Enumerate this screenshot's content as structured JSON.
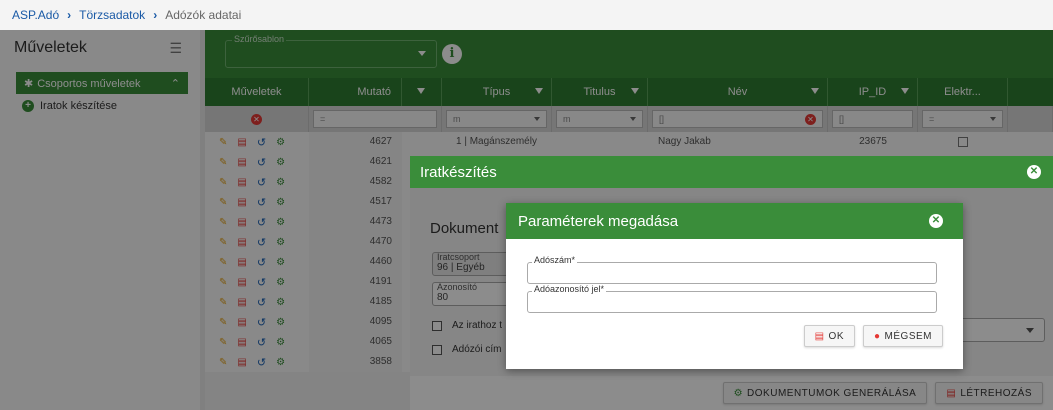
{
  "breadcrumb": {
    "items": [
      "ASP.Adó",
      "Törzsadatok"
    ],
    "current": "Adózók adatai"
  },
  "sidebar": {
    "title": "Műveletek",
    "group_label": "Csoportos műveletek",
    "item_label": "Iratok készítése"
  },
  "filterbar": {
    "template_label": "Szűrősablon"
  },
  "grid": {
    "headers": [
      "Műveletek",
      "Mutató",
      "Típus",
      "Titulus",
      "Név",
      "IP_ID",
      "Elektr..."
    ],
    "filter_values": [
      "=",
      "m",
      "m",
      "[]",
      "[]",
      "="
    ],
    "rows": [
      {
        "mutato": "4627",
        "tipus": "1 | Magánszemély",
        "nev": "Nagy Jakab",
        "ip_id": "23675"
      },
      {
        "mutato": "4621"
      },
      {
        "mutato": "4582"
      },
      {
        "mutato": "4517"
      },
      {
        "mutato": "4473"
      },
      {
        "mutato": "4470"
      },
      {
        "mutato": "4460"
      },
      {
        "mutato": "4191"
      },
      {
        "mutato": "4185"
      },
      {
        "mutato": "4095"
      },
      {
        "mutato": "4065"
      },
      {
        "mutato": "3858"
      }
    ]
  },
  "dialog_outer": {
    "title": "Iratkészítés",
    "section_title": "Dokument",
    "iratcsoport_label": "Iratcsoport",
    "iratcsoport_value": "96 | Egyéb",
    "azonosito_label": "Azonosító",
    "azonosito_value": "80",
    "check1_label": "Az irathoz t",
    "check2_label": "Adózói cím",
    "btn_generate": "DOKUMENTUMOK GENERÁLÁSA",
    "btn_create": "LÉTREHOZÁS"
  },
  "dialog_inner": {
    "title": "Paraméterek megadása",
    "field1_label": "Adószám*",
    "field1_value": "",
    "field2_label": "Adóazonosító jel*",
    "field2_value": "",
    "btn_ok": "OK",
    "btn_cancel": "MÉGSEM"
  },
  "colors": {
    "accent": "#3a8d3a",
    "header_dark": "#2e7d32",
    "danger": "#e53935"
  }
}
